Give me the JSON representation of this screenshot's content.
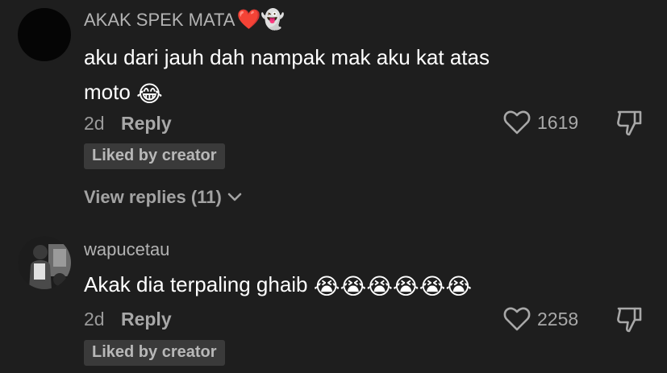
{
  "comments": [
    {
      "username": "AKAK SPEK MATA",
      "username_emoji": "❤️👻",
      "text_lines": [
        "aku dari jauh dah nampak mak aku kat atas",
        "moto"
      ],
      "text_emoji": "😂",
      "time": "2d",
      "reply_label": "Reply",
      "likes": "1619",
      "badge": "Liked by creator",
      "view_replies": "View replies (11)"
    },
    {
      "username": "wapucetau",
      "text": "Akak dia terpaling ghaib",
      "text_emoji": "😭😭😭😭😭😭",
      "time": "2d",
      "reply_label": "Reply",
      "likes": "2258",
      "badge": "Liked by creator"
    }
  ],
  "icons": {
    "like": "heart-outline-icon",
    "dislike": "thumbs-down-icon",
    "expand": "chevron-down-icon"
  },
  "colors": {
    "background": "#1e1e1e",
    "username": "#b3b3b3",
    "text": "#ffffff",
    "meta": "#9a9a9a",
    "badge_bg": "#3a3a3a"
  }
}
